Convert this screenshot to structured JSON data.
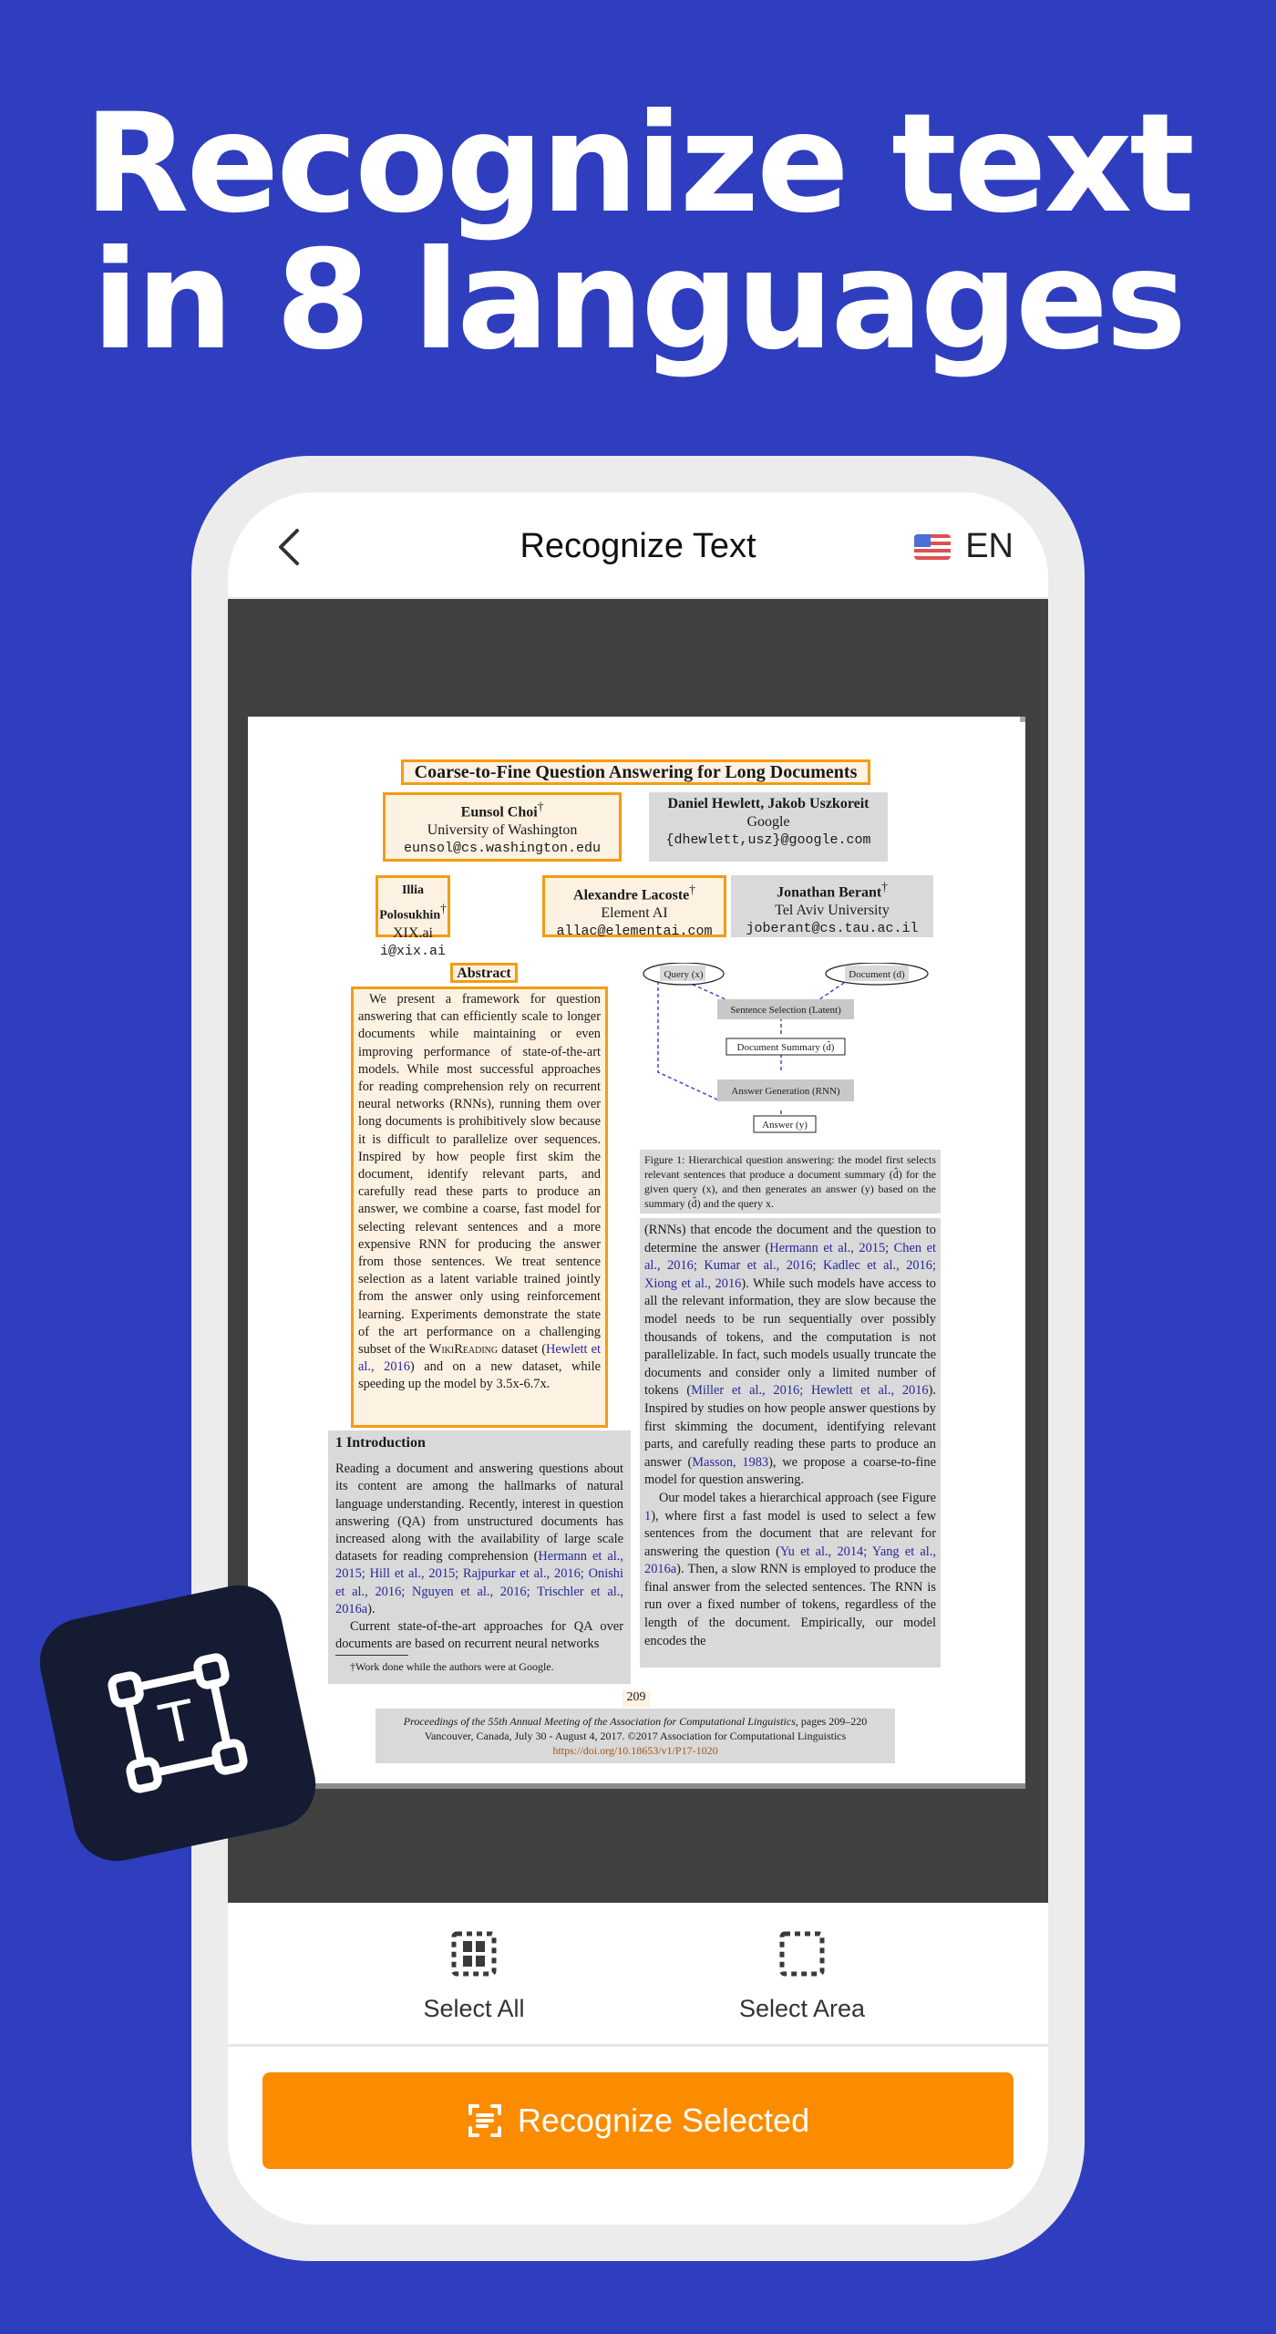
{
  "promo": {
    "headline_line1": "Recognize text",
    "headline_line2": "in 8 languages"
  },
  "navbar": {
    "title": "Recognize Text",
    "back_icon": "chevron-left-icon",
    "language_flag": "us-flag-icon",
    "language_code": "EN"
  },
  "document": {
    "title": "Coarse-to-Fine Question Answering for Long Documents",
    "authors": [
      {
        "name": "Eunsol Choi",
        "mark": "†",
        "affiliation": "University of Washington",
        "email": "eunsol@cs.washington.edu",
        "selected": true
      },
      {
        "name": "Daniel Hewlett, Jakob Uszkoreit",
        "mark": "",
        "affiliation": "Google",
        "email": "{dhewlett,usz}@google.com",
        "selected": false
      },
      {
        "name": "Illia Polosukhin",
        "mark": "†",
        "affiliation": "XIX.ai",
        "email": "i@xix.ai",
        "selected": true
      },
      {
        "name": "Alexandre Lacoste",
        "mark": "†",
        "affiliation": "Element AI",
        "email": "allac@elementai.com",
        "selected": true
      },
      {
        "name": "Jonathan Berant",
        "mark": "†",
        "affiliation": "Tel Aviv University",
        "email": "joberant@cs.tau.ac.il",
        "selected": false
      }
    ],
    "abstract_heading": "Abstract",
    "abstract_text_1": "We present a framework for question answering that can efficiently scale to longer documents while maintaining or even improving performance of state-of-the-art models. While most successful approaches for reading comprehension rely on recurrent neural networks (RNNs), running them over long documents is prohibitively slow because it is difficult to parallelize over sequences. Inspired by how people first skim the document, identify relevant parts, and carefully read these parts to produce an answer, we combine a coarse, fast model for selecting relevant sentences and a more expensive RNN for producing the answer from those sentences. We treat sentence selection as a latent variable trained jointly from the answer only using reinforcement learning. Experiments demonstrate the state of the art performance on a challenging subset of the ",
    "abstract_dataset": "WikiReading",
    "abstract_text_2": " dataset (",
    "abstract_cite": "Hewlett et al., 2016",
    "abstract_text_3": ") and on a new dataset, while speeding up the model by 3.5x-6.7x.",
    "intro_heading": "1   Introduction",
    "intro_p1_text": "Reading a document and answering questions about its content are among the hallmarks of natural language understanding. Recently, interest in question answering (QA) from unstructured documents has increased along with the availability of large scale datasets for reading comprehension (",
    "intro_p1_cite": "Hermann et al., 2015; Hill et al., 2015; Rajpurkar et al., 2016; Onishi et al., 2016; Nguyen et al., 2016; Trischler et al., 2016a",
    "intro_p1_end": ").",
    "intro_p2": "Current state-of-the-art approaches for QA over documents are based on recurrent neural networks",
    "footnote": "†Work done while the authors were at Google.",
    "figure": {
      "nodes": {
        "query": "Query (x)",
        "document": "Document (d)",
        "selection": "Sentence Selection (Latent)",
        "summary": "Document Summary (d̂)",
        "generation": "Answer Generation (RNN)",
        "answer": "Answer (y)"
      },
      "caption": "Figure 1: Hierarchical question answering: the model first selects relevant sentences that produce a document summary (d̂) for the given query (x), and then generates an answer (y) based on the summary (d̂) and the query x."
    },
    "right_col": {
      "p1_a": "(RNNs) that encode the document and the question to determine the answer (",
      "p1_cite1": "Hermann et al., 2015; Chen et al., 2016; Kumar et al., 2016; Kadlec et al., 2016; Xiong et al., 2016",
      "p1_b": "). While such models have access to all the relevant information, they are slow because the model needs to be run sequentially over possibly thousands of tokens, and the computation is not parallelizable. In fact, such models usually truncate the documents and consider only a limited number of tokens (",
      "p1_cite2": "Miller et al., 2016; Hewlett et al., 2016",
      "p1_c": "). Inspired by studies on how people answer questions by first skimming the document, identifying relevant parts, and carefully reading these parts to produce an answer (",
      "p1_cite3": "Masson, 1983",
      "p1_d": "), we propose a coarse-to-fine model for question answering.",
      "p2_a": "Our model takes a hierarchical approach (see Figure ",
      "p2_fig": "1",
      "p2_b": "), where first a fast model is used to select a few sentences from the document that are relevant for answering the question (",
      "p2_cite": "Yu et al., 2014; Yang et al., 2016a",
      "p2_c": "). Then, a slow RNN is employed to produce the final answer from the selected sentences. The RNN is run over a fixed number of tokens, regardless of the length of the document. Empirically, our model encodes the"
    },
    "page_number": "209",
    "proceedings_line1": "Proceedings of the 55th Annual Meeting of the Association for Computational Linguistics",
    "proceedings_pages": ", pages 209–220",
    "proceedings_line2": "Vancouver, Canada, July 30 - August 4, 2017. ©2017 Association for Computational Linguistics",
    "doi": "https://doi.org/10.18653/v1/P17-1020"
  },
  "toolbar": {
    "select_all_label": "Select All",
    "select_all_icon": "select-all-icon",
    "select_area_label": "Select Area",
    "select_area_icon": "select-area-icon"
  },
  "cta": {
    "label": "Recognize Selected",
    "icon": "scan-text-icon"
  },
  "badge": {
    "icon": "text-select-icon",
    "glyph": "T"
  },
  "colors": {
    "background": "#2e3ebe",
    "accent": "#fb8c00",
    "selection_border": "#f39c12",
    "selection_fill": "#fdf1e2",
    "unselected_fill": "#d9d9d9",
    "viewer_bg": "#404040",
    "badge_bg": "#151b33",
    "citation": "#26279a"
  }
}
